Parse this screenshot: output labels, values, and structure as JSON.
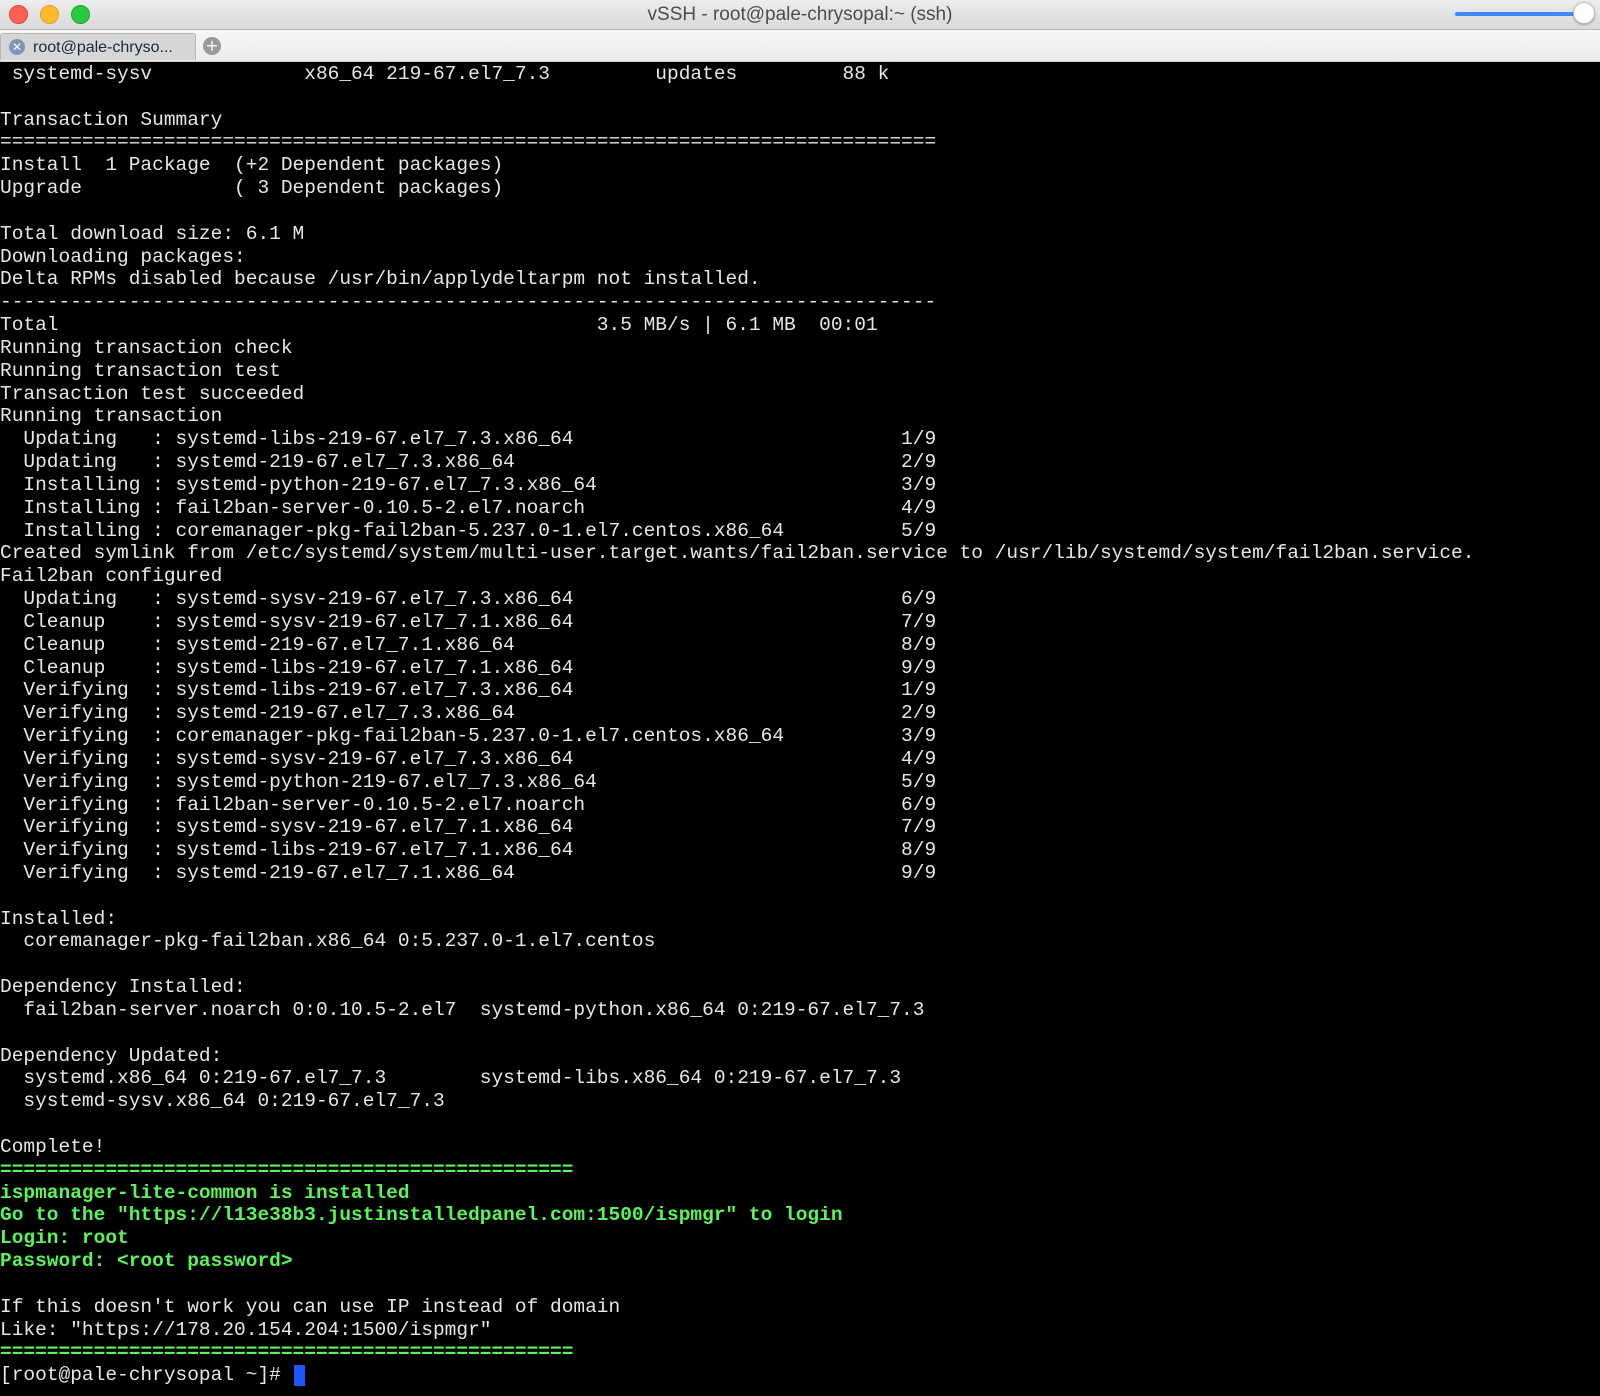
{
  "window": {
    "title": "vSSH - root@pale-chrysopal:~ (ssh)"
  },
  "tabs": [
    {
      "label": "root@pale-chryso..."
    }
  ],
  "terminal": {
    "prompt": "[root@pale-chrysopal ~]# ",
    "lines": [
      {
        "text": " systemd-sysv             x86_64 219-67.el7_7.3         updates         88 k",
        "style": "normal"
      },
      {
        "text": "",
        "style": "normal"
      },
      {
        "text": "Transaction Summary",
        "style": "normal"
      },
      {
        "text": "================================================================================",
        "style": "normal"
      },
      {
        "text": "Install  1 Package  (+2 Dependent packages)",
        "style": "normal"
      },
      {
        "text": "Upgrade             ( 3 Dependent packages)",
        "style": "normal"
      },
      {
        "text": "",
        "style": "normal"
      },
      {
        "text": "Total download size: 6.1 M",
        "style": "normal"
      },
      {
        "text": "Downloading packages:",
        "style": "normal"
      },
      {
        "text": "Delta RPMs disabled because /usr/bin/applydeltarpm not installed.",
        "style": "normal"
      },
      {
        "text": "--------------------------------------------------------------------------------",
        "style": "normal"
      },
      {
        "text": "Total                                              3.5 MB/s | 6.1 MB  00:01",
        "style": "normal"
      },
      {
        "text": "Running transaction check",
        "style": "normal"
      },
      {
        "text": "Running transaction test",
        "style": "normal"
      },
      {
        "text": "Transaction test succeeded",
        "style": "normal"
      },
      {
        "text": "Running transaction",
        "style": "normal"
      },
      {
        "text": "  Updating   : systemd-libs-219-67.el7_7.3.x86_64                            1/9",
        "style": "normal"
      },
      {
        "text": "  Updating   : systemd-219-67.el7_7.3.x86_64                                 2/9",
        "style": "normal"
      },
      {
        "text": "  Installing : systemd-python-219-67.el7_7.3.x86_64                          3/9",
        "style": "normal"
      },
      {
        "text": "  Installing : fail2ban-server-0.10.5-2.el7.noarch                           4/9",
        "style": "normal"
      },
      {
        "text": "  Installing : coremanager-pkg-fail2ban-5.237.0-1.el7.centos.x86_64          5/9",
        "style": "normal"
      },
      {
        "text": "Created symlink from /etc/systemd/system/multi-user.target.wants/fail2ban.service to /usr/lib/systemd/system/fail2ban.service.",
        "style": "normal"
      },
      {
        "text": "Fail2ban configured",
        "style": "normal"
      },
      {
        "text": "  Updating   : systemd-sysv-219-67.el7_7.3.x86_64                            6/9",
        "style": "normal"
      },
      {
        "text": "  Cleanup    : systemd-sysv-219-67.el7_7.1.x86_64                            7/9",
        "style": "normal"
      },
      {
        "text": "  Cleanup    : systemd-219-67.el7_7.1.x86_64                                 8/9",
        "style": "normal"
      },
      {
        "text": "  Cleanup    : systemd-libs-219-67.el7_7.1.x86_64                            9/9",
        "style": "normal"
      },
      {
        "text": "  Verifying  : systemd-libs-219-67.el7_7.3.x86_64                            1/9",
        "style": "normal"
      },
      {
        "text": "  Verifying  : systemd-219-67.el7_7.3.x86_64                                 2/9",
        "style": "normal"
      },
      {
        "text": "  Verifying  : coremanager-pkg-fail2ban-5.237.0-1.el7.centos.x86_64          3/9",
        "style": "normal"
      },
      {
        "text": "  Verifying  : systemd-sysv-219-67.el7_7.3.x86_64                            4/9",
        "style": "normal"
      },
      {
        "text": "  Verifying  : systemd-python-219-67.el7_7.3.x86_64                          5/9",
        "style": "normal"
      },
      {
        "text": "  Verifying  : fail2ban-server-0.10.5-2.el7.noarch                           6/9",
        "style": "normal"
      },
      {
        "text": "  Verifying  : systemd-sysv-219-67.el7_7.1.x86_64                            7/9",
        "style": "normal"
      },
      {
        "text": "  Verifying  : systemd-libs-219-67.el7_7.1.x86_64                            8/9",
        "style": "normal"
      },
      {
        "text": "  Verifying  : systemd-219-67.el7_7.1.x86_64                                 9/9",
        "style": "normal"
      },
      {
        "text": "",
        "style": "normal"
      },
      {
        "text": "Installed:",
        "style": "normal"
      },
      {
        "text": "  coremanager-pkg-fail2ban.x86_64 0:5.237.0-1.el7.centos",
        "style": "normal"
      },
      {
        "text": "",
        "style": "normal"
      },
      {
        "text": "Dependency Installed:",
        "style": "normal"
      },
      {
        "text": "  fail2ban-server.noarch 0:0.10.5-2.el7  systemd-python.x86_64 0:219-67.el7_7.3",
        "style": "normal"
      },
      {
        "text": "",
        "style": "normal"
      },
      {
        "text": "Dependency Updated:",
        "style": "normal"
      },
      {
        "text": "  systemd.x86_64 0:219-67.el7_7.3        systemd-libs.x86_64 0:219-67.el7_7.3",
        "style": "normal"
      },
      {
        "text": "  systemd-sysv.x86_64 0:219-67.el7_7.3",
        "style": "normal"
      },
      {
        "text": "",
        "style": "normal"
      },
      {
        "text": "Complete!",
        "style": "normal"
      },
      {
        "text": "=================================================",
        "style": "green"
      },
      {
        "text": "ispmanager-lite-common is installed",
        "style": "green"
      },
      {
        "text": "Go to the \"https://l13e38b3.justinstalledpanel.com:1500/ispmgr\" to login",
        "style": "green"
      },
      {
        "text": "Login: root",
        "style": "green"
      },
      {
        "text": "Password: <root password>",
        "style": "green"
      },
      {
        "text": "",
        "style": "normal"
      },
      {
        "text": "If this doesn't work you can use IP instead of domain",
        "style": "normal"
      },
      {
        "text": "Like: \"https://178.20.154.204:1500/ispmgr\"",
        "style": "normal"
      },
      {
        "text": "=================================================",
        "style": "green"
      }
    ]
  },
  "colors": {
    "terminal_bg": "#000000",
    "terminal_fg": "#e7e7e7",
    "highlight_green": "#57f557",
    "cursor": "#1f57ff"
  }
}
